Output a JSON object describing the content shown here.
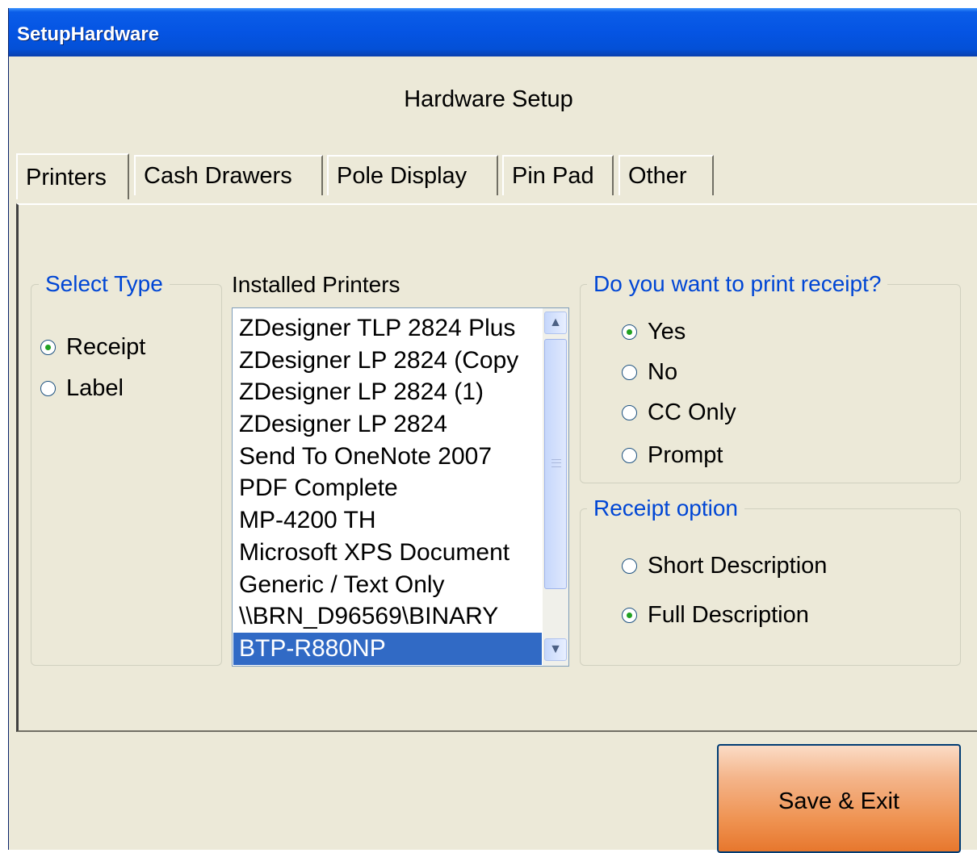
{
  "window": {
    "title": "SetupHardware"
  },
  "heading": "Hardware Setup",
  "tabs": [
    "Printers",
    "Cash Drawers",
    "Pole Display",
    "Pin Pad",
    "Other"
  ],
  "active_tab": "Printers",
  "select_type": {
    "legend": "Select Type",
    "options": [
      "Receipt",
      "Label"
    ],
    "selected": "Receipt"
  },
  "installed_printers": {
    "label": "Installed Printers",
    "items": [
      "ZDesigner TLP 2824 Plus",
      "ZDesigner LP 2824 (Copy",
      "ZDesigner LP 2824 (1)",
      "ZDesigner LP 2824",
      "Send To OneNote 2007",
      "PDF Complete",
      "MP-4200 TH",
      "Microsoft XPS Document",
      "Generic / Text Only",
      "\\\\BRN_D96569\\BINARY",
      "BTP-R880NP"
    ],
    "selected": "BTP-R880NP"
  },
  "print_receipt": {
    "legend": "Do you want to print receipt?",
    "options": [
      "Yes",
      "No",
      "CC Only",
      "Prompt"
    ],
    "selected": "Yes"
  },
  "receipt_option": {
    "legend": "Receipt option",
    "options": [
      "Short Description",
      "Full Description"
    ],
    "selected": "Full Description"
  },
  "buttons": {
    "save_exit": "Save & Exit"
  },
  "colors": {
    "titlebar": "#0554e3",
    "window_bg": "#ece9d8",
    "legend_text": "#0046d5",
    "selection": "#316ac5",
    "save_button": "#ef9352"
  }
}
